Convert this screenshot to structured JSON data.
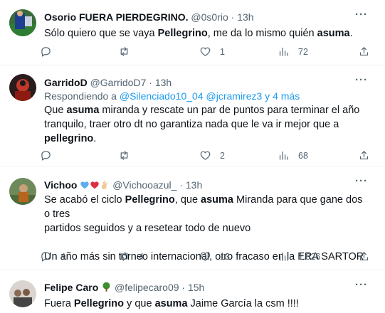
{
  "tweets": [
    {
      "name": "Osorio FUERA PIERDEGRINO.",
      "handle": "@0s0rio",
      "time": "13h",
      "more": "···",
      "body": [
        [
          {
            "t": "Sólo quiero que se vaya "
          },
          {
            "t": "Pellegrino",
            "b": true
          },
          {
            "t": ", me da lo mismo quién "
          },
          {
            "t": "asuma",
            "b": true
          },
          {
            "t": "."
          }
        ]
      ],
      "counts": {
        "reply": "",
        "retweet": "",
        "like": "1",
        "views": "72"
      }
    },
    {
      "name": "GarridoD",
      "handle": "@GarridoD7",
      "time": "13h",
      "more": "···",
      "reply_prefix": "Respondiendo a",
      "reply_users": "@Silenciado10_04 @jcramirez3 y 4 más",
      "body": [
        [
          {
            "t": "Que "
          },
          {
            "t": "asuma",
            "b": true
          },
          {
            "t": " miranda y rescate un par de puntos para terminar el año"
          }
        ],
        [
          {
            "t": "tranquilo, traer otro dt no garantiza nada que le va ir mejor que a"
          }
        ],
        [
          {
            "t": "pellegrino",
            "b": true
          },
          {
            "t": "."
          }
        ]
      ],
      "counts": {
        "reply": "",
        "retweet": "",
        "like": "2",
        "views": "68"
      }
    },
    {
      "name": "Vichoo",
      "handle": "@Vichooazul_",
      "time": "13h",
      "more": "···",
      "body": [
        [
          {
            "t": "Se acabó el ciclo "
          },
          {
            "t": "Pellegrino",
            "b": true
          },
          {
            "t": ", que "
          },
          {
            "t": "asuma",
            "b": true
          },
          {
            "t": " Miranda para que gane dos o tres"
          }
        ],
        [
          {
            "t": "partidos seguidos y a resetear todo de nuevo"
          }
        ],
        [
          {
            "t": " "
          }
        ],
        [
          {
            "t": "Un año más sin torneo internacional, otro fracaso en la ERA SARTOR"
          }
        ]
      ],
      "counts": {
        "reply": "4",
        "retweet": "4",
        "like": "13",
        "views": "1.026"
      }
    },
    {
      "name": "Felipe Caro",
      "handle": "@felipecaro09",
      "time": "15h",
      "more": "···",
      "body": [
        [
          {
            "t": "Fuera "
          },
          {
            "t": "Pellegrino",
            "b": true
          },
          {
            "t": " y que "
          },
          {
            "t": "asuma",
            "b": true
          },
          {
            "t": " Jaime García la csm !!!!"
          }
        ]
      ],
      "counts": {
        "reply": "",
        "retweet": "",
        "like": "",
        "views": ""
      }
    }
  ],
  "colors": {
    "text": "#0f1419",
    "muted": "#536471",
    "link": "#1d9bf0",
    "divider": "#eff3f4"
  },
  "icons": [
    "reply-icon",
    "retweet-icon",
    "like-icon",
    "views-icon",
    "share-icon",
    "more-icon",
    "tree-emoji",
    "heart-emoji",
    "hand-emoji"
  ]
}
